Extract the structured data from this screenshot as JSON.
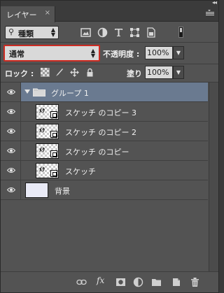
{
  "panel": {
    "collapse_glyph": "◂◂",
    "tab_label": "レイヤー",
    "tab_close": "×",
    "menu_glyph": "≡"
  },
  "filter": {
    "label": "種類",
    "search_glyph": "⚲"
  },
  "blend": {
    "mode": "通常",
    "opacity_label": "不透明度 :",
    "opacity_value": "100%"
  },
  "lock": {
    "label": "ロック :",
    "fill_label": "塗り :",
    "fill_value": "100%"
  },
  "layers": [
    {
      "name": "グループ 1",
      "type": "group",
      "selected": true,
      "expanded": true
    },
    {
      "name": "スケッチ のコピー 3",
      "type": "layer",
      "indent": true
    },
    {
      "name": "スケッチ のコピー 2",
      "type": "layer",
      "indent": true
    },
    {
      "name": "スケッチ のコピー",
      "type": "layer",
      "indent": true
    },
    {
      "name": "スケッチ",
      "type": "layer",
      "indent": true
    },
    {
      "name": "背景",
      "type": "background"
    }
  ],
  "thumb_glyph": "ﾒｸ",
  "icons": {
    "eye": "eye-icon",
    "folder": "folder-icon",
    "link": "link-icon",
    "fx": "fx",
    "mask": "mask-icon",
    "adjustment": "adjustment-icon",
    "new_group": "new-group-icon",
    "new_layer": "new-layer-icon",
    "delete": "trash-icon"
  },
  "colors": {
    "panel_bg": "#535353",
    "selected_row": "#6a7a90",
    "highlight_border": "#cc2b22"
  }
}
